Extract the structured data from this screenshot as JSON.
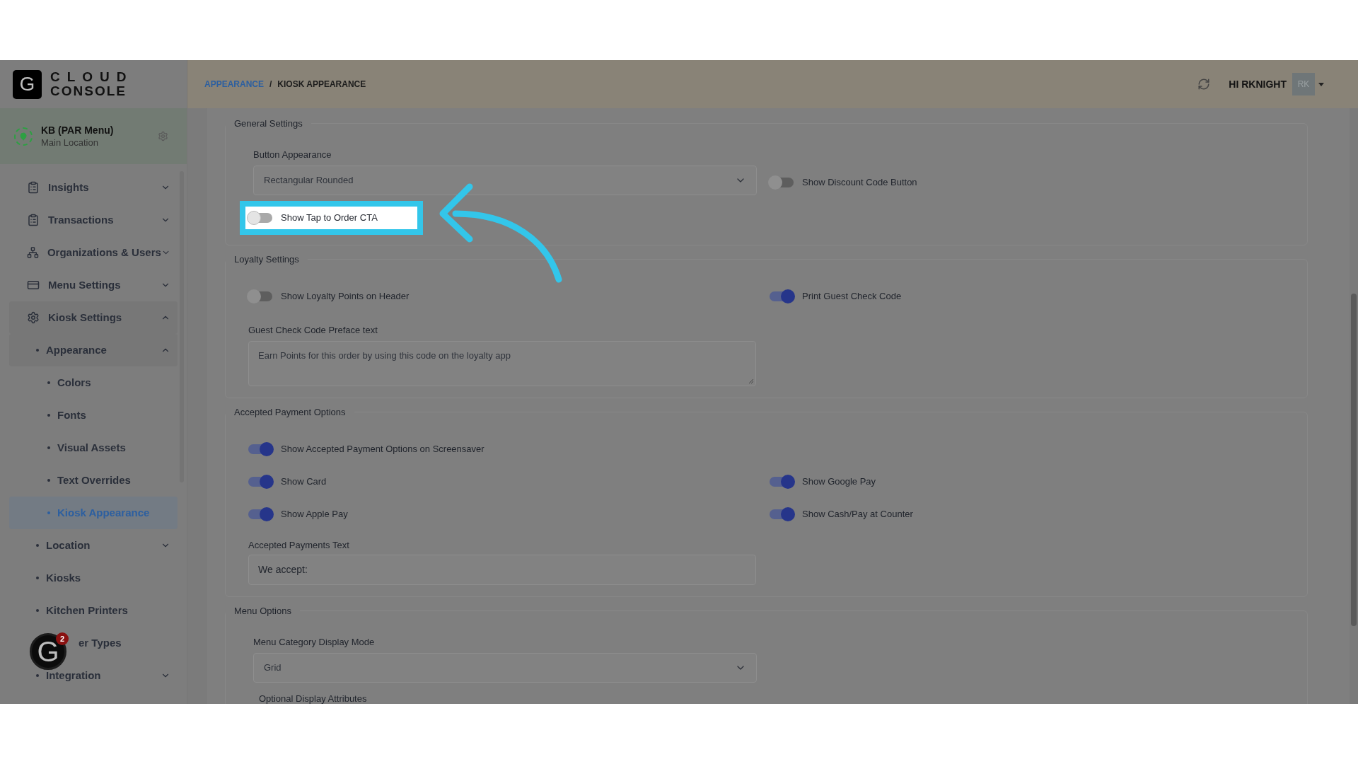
{
  "sidebar": {
    "logo": {
      "mark": "G",
      "line1": "CLOUD",
      "line2": "CONSOLE"
    },
    "location": {
      "name": "KB (PAR Menu)",
      "subtitle": "Main Location"
    },
    "items": [
      {
        "label": "Insights",
        "expanded": false,
        "selected": false
      },
      {
        "label": "Transactions",
        "expanded": false,
        "selected": false
      },
      {
        "label": "Organizations & Users",
        "expanded": false,
        "selected": false
      },
      {
        "label": "Menu Settings",
        "expanded": false,
        "selected": false
      },
      {
        "label": "Kiosk Settings",
        "expanded": true,
        "selected": false,
        "children": [
          {
            "label": "Appearance",
            "expanded": true,
            "selected": false,
            "children": [
              {
                "label": "Colors",
                "selected": false
              },
              {
                "label": "Fonts",
                "selected": false
              },
              {
                "label": "Visual Assets",
                "selected": false
              },
              {
                "label": "Text Overrides",
                "selected": false
              },
              {
                "label": "Kiosk Appearance",
                "selected": true
              }
            ]
          },
          {
            "label": "Location",
            "expanded": false,
            "selected": false
          },
          {
            "label": "Kiosks",
            "selected": false
          },
          {
            "label": "Kitchen Printers",
            "selected": false
          },
          {
            "label": "er Types",
            "selected": false,
            "covered": true
          },
          {
            "label": "Integration",
            "expanded": false,
            "selected": false
          }
        ]
      }
    ]
  },
  "chat_widget": {
    "mark": "G",
    "count": "2"
  },
  "header": {
    "breadcrumbs": [
      {
        "label": "APPEARANCE",
        "link": true
      },
      {
        "label": "KIOSK APPEARANCE",
        "link": false
      }
    ],
    "separator": "/",
    "greeting": "HI RKNIGHT",
    "avatar": "RK"
  },
  "sections": [
    {
      "title": "General Settings",
      "rows": [
        [
          {
            "kind": "select",
            "label": "Button Appearance",
            "value": "Rectangular Rounded"
          },
          {
            "kind": "toggle",
            "label": "Show Discount Code Button",
            "on": false,
            "highlighted": false
          }
        ],
        [
          {
            "kind": "toggle",
            "label": "Show Tap to Order CTA",
            "on": false,
            "highlighted": true
          }
        ]
      ]
    },
    {
      "title": "Loyalty Settings",
      "rows": [
        [
          {
            "kind": "toggle",
            "label": "Show Loyalty Points on Header",
            "on": false,
            "highlighted": false
          },
          {
            "kind": "toggle",
            "label": "Print Guest Check Code",
            "on": true,
            "highlighted": false
          }
        ],
        [
          {
            "kind": "textarea",
            "label": "Guest Check Code Preface text",
            "value": "Earn Points for this order by using this code on the loyalty app"
          }
        ]
      ]
    },
    {
      "title": "Accepted Payment Options",
      "rows": [
        [
          {
            "kind": "toggle",
            "label": "Show Accepted Payment Options on Screensaver",
            "on": true,
            "highlighted": false
          }
        ],
        [
          {
            "kind": "toggle",
            "label": "Show Card",
            "on": true,
            "highlighted": false
          },
          {
            "kind": "toggle",
            "label": "Show Google Pay",
            "on": true,
            "highlighted": false
          }
        ],
        [
          {
            "kind": "toggle",
            "label": "Show Apple Pay",
            "on": true,
            "highlighted": false
          },
          {
            "kind": "toggle",
            "label": "Show Cash/Pay at Counter",
            "on": true,
            "highlighted": false
          }
        ],
        [
          {
            "kind": "input",
            "label": "Accepted Payments Text",
            "value": "We accept:"
          }
        ]
      ]
    },
    {
      "title": "Menu Options",
      "rows": [
        [
          {
            "kind": "select",
            "label": "Menu Category Display Mode",
            "value": "Grid"
          }
        ],
        [
          {
            "kind": "heading",
            "label": "Optional Display Attributes"
          }
        ]
      ]
    }
  ]
}
